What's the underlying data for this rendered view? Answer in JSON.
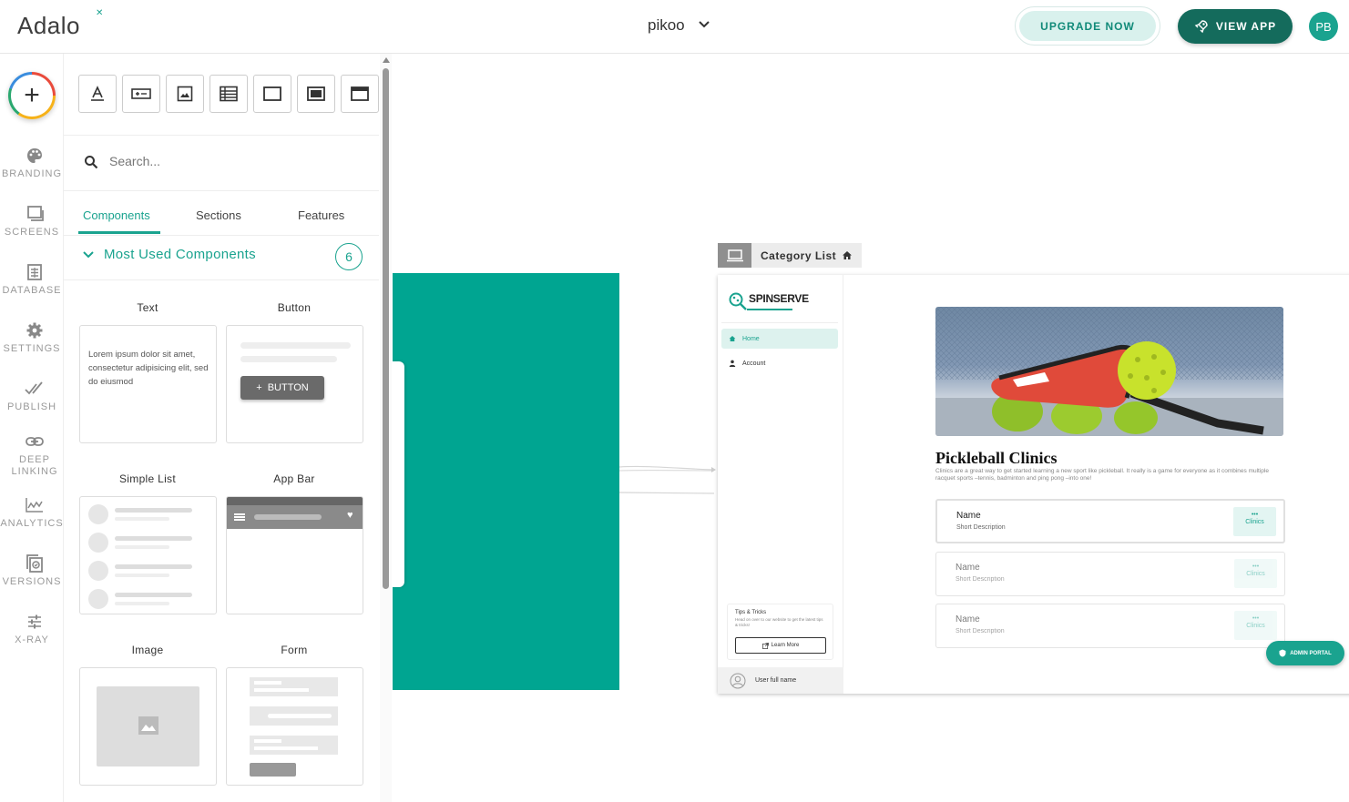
{
  "header": {
    "logo": "Adalo",
    "app_name": "pikoo",
    "upgrade_label": "UPGRADE NOW",
    "view_app_label": "VIEW APP",
    "user_initials": "PB"
  },
  "rail": {
    "items": [
      {
        "label": "BRANDING",
        "icon": "palette-icon"
      },
      {
        "label": "SCREENS",
        "icon": "screens-icon"
      },
      {
        "label": "DATABASE",
        "icon": "database-icon"
      },
      {
        "label": "SETTINGS",
        "icon": "gear-icon"
      },
      {
        "label": "PUBLISH",
        "icon": "publish-icon"
      },
      {
        "label": "DEEP LINKING",
        "icon": "link-icon"
      },
      {
        "label": "ANALYTICS",
        "icon": "analytics-icon"
      },
      {
        "label": "VERSIONS",
        "icon": "versions-icon"
      },
      {
        "label": "X-RAY",
        "icon": "xray-icon"
      }
    ]
  },
  "panel": {
    "search_placeholder": "Search...",
    "tabs": [
      {
        "label": "Components",
        "active": true
      },
      {
        "label": "Sections",
        "active": false
      },
      {
        "label": "Features",
        "active": false
      }
    ],
    "section_title": "Most Used Components",
    "section_count": "6",
    "components": [
      {
        "label": "Text",
        "preview_text": "Lorem ipsum dolor sit amet, consectetur adipisicing elit, sed do eiusmod"
      },
      {
        "label": "Button",
        "preview_button": "BUTTON"
      },
      {
        "label": "Simple List"
      },
      {
        "label": "App Bar"
      },
      {
        "label": "Image"
      },
      {
        "label": "Form"
      }
    ]
  },
  "canvas": {
    "screen_name": "Category List",
    "preview": {
      "brand": "SPINSERVE",
      "nav": [
        {
          "label": "Home",
          "active": true
        },
        {
          "label": "Account",
          "active": false
        }
      ],
      "tips_title": "Tips & Tricks",
      "tips_body": "Head on over to our website to get the latest tips & tricks!",
      "tips_button": "Learn More",
      "user_label": "User full name",
      "title": "Pickleball Clinics",
      "description": "Clinics are a great way to get started learning a new sport like pickleball. It really is a game for everyone as it combines multiple racquet sports –tennis, badminton and ping pong –into one!",
      "cards": [
        {
          "name": "Name",
          "sub": "Short Description",
          "pill": "Clinics"
        },
        {
          "name": "Name",
          "sub": "Short Description",
          "pill": "Clinics"
        },
        {
          "name": "Name",
          "sub": "Short Description",
          "pill": "Clinics"
        }
      ],
      "admin_label": "ADMIN PORTAL"
    }
  },
  "colors": {
    "accent": "#1aa38f",
    "dark_accent": "#146b5c",
    "teal_screen": "#00a591"
  }
}
